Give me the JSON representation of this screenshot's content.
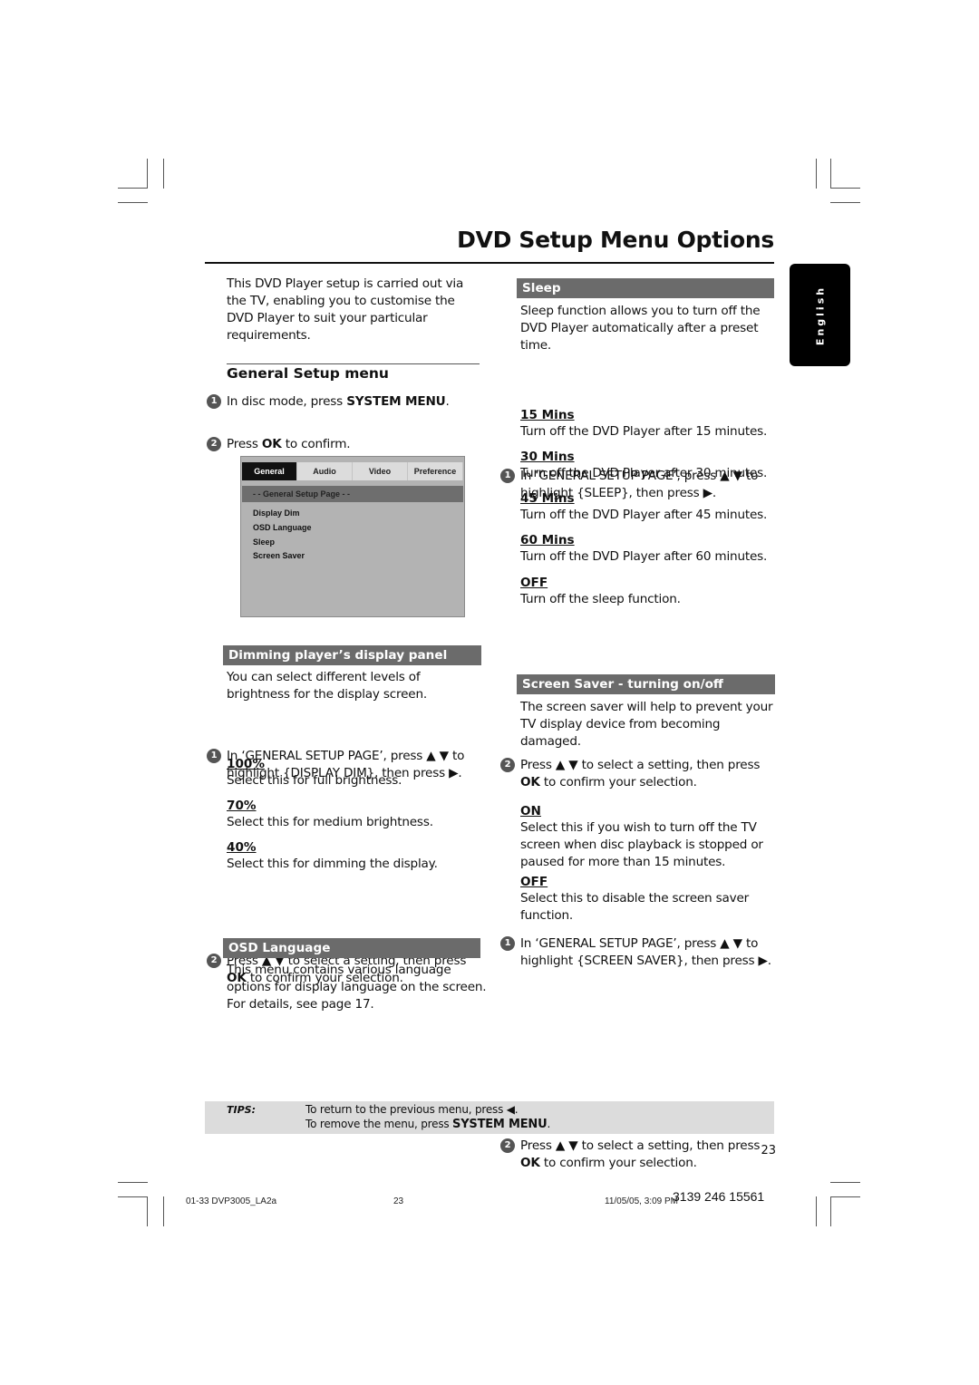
{
  "page": {
    "title": "DVD Setup Menu Options",
    "language_tab": "English",
    "page_number": "23"
  },
  "intro": {
    "text_lines": [
      "This DVD Player setup is carried out via",
      "the TV, enabling you to customise the",
      "DVD Player to suit your particular",
      "requirements."
    ]
  },
  "general_setup": {
    "heading": "General Setup menu",
    "steps": [
      {
        "num": "1",
        "pre": "In disc mode, press ",
        "bold": "SYSTEM MENU",
        "post": "."
      },
      {
        "num": "2",
        "pre": "Press ",
        "bold": "OK",
        "post": " to confirm."
      }
    ]
  },
  "osd_menu": {
    "tabs": [
      "General",
      "Audio",
      "Video",
      "Preference"
    ],
    "active_tab": "General",
    "header": "- -   General Setup Page   - -",
    "items": [
      "Display Dim",
      "OSD Language",
      "Sleep",
      "Screen Saver"
    ]
  },
  "dimming": {
    "heading": "Dimming player’s display panel",
    "intro_lines": [
      "You can select different levels of",
      "brightness for the display screen."
    ],
    "step1": {
      "num": "1",
      "line1": "In ‘GENERAL SETUP PAGE’, press ▲ ▼ to",
      "line2": "highlight {DISPLAY DIM}, then press ▶."
    },
    "options": [
      {
        "label": "100%",
        "desc": "Select this for full brightness."
      },
      {
        "label": "70%",
        "desc": "Select this for medium brightness."
      },
      {
        "label": "40%",
        "desc": "Select this for dimming the display."
      }
    ],
    "step2": {
      "num": "2",
      "line1": "Press ▲ ▼ to select a setting, then press",
      "bold": "OK",
      "line2_post": " to confirm your selection."
    }
  },
  "osd_language": {
    "heading": "OSD Language",
    "text_lines": [
      "This menu contains various language",
      "options for display language on the screen.",
      "For details, see page 17."
    ]
  },
  "sleep": {
    "heading": "Sleep",
    "intro_lines": [
      "Sleep function allows you to turn off the",
      "DVD Player automatically after a preset",
      "time."
    ],
    "step1": {
      "num": "1",
      "line1": "In ‘GENERAL SETUP PAGE’, press ▲ ▼ to",
      "line2": "highlight {SLEEP}, then press ▶."
    },
    "options": [
      {
        "label": "15 Mins",
        "desc": "Turn off the DVD Player after 15 minutes."
      },
      {
        "label": "30 Mins",
        "desc": "Turn off the DVD Player after 30 minutes."
      },
      {
        "label": "45 Mins",
        "desc": "Turn off the DVD Player after 45 minutes."
      },
      {
        "label": "60 Mins",
        "desc": "Turn off the DVD Player after 60 minutes."
      },
      {
        "label": "OFF",
        "desc": "Turn off the sleep function."
      }
    ],
    "step2": {
      "num": "2",
      "line1": "Press ▲ ▼ to select a setting, then press",
      "bold": "OK",
      "line2_post": " to confirm your selection."
    }
  },
  "screen_saver": {
    "heading": "Screen Saver - turning on/off",
    "intro_lines": [
      "The screen saver will help to prevent your",
      "TV display device from becoming",
      "damaged."
    ],
    "step1": {
      "num": "1",
      "line1": "In ‘GENERAL SETUP PAGE’, press ▲ ▼ to",
      "line2": "highlight {SCREEN SAVER}, then press ▶."
    },
    "options": [
      {
        "label": "ON",
        "desc_lines": [
          "Select this if you wish to turn off the TV",
          "screen when disc playback is stopped or",
          "paused for more than 15 minutes."
        ]
      },
      {
        "label": "OFF",
        "desc_lines": [
          "Select this to disable the screen saver",
          "function."
        ]
      }
    ],
    "step2": {
      "num": "2",
      "line1": "Press ▲ ▼ to select a setting, then press",
      "bold": "OK",
      "line2_post": " to confirm your selection."
    }
  },
  "tips": {
    "label": "TIPS:",
    "line1": "To return to the previous menu, press ◀.",
    "line2_pre": "To remove the menu, press ",
    "line2_bold": "SYSTEM MENU",
    "line2_post": "."
  },
  "footer": {
    "file": "01-33 DVP3005_LA2a",
    "page": "23",
    "datetime": "11/05/05, 3:09 PM",
    "code": "3139 246 15561"
  }
}
